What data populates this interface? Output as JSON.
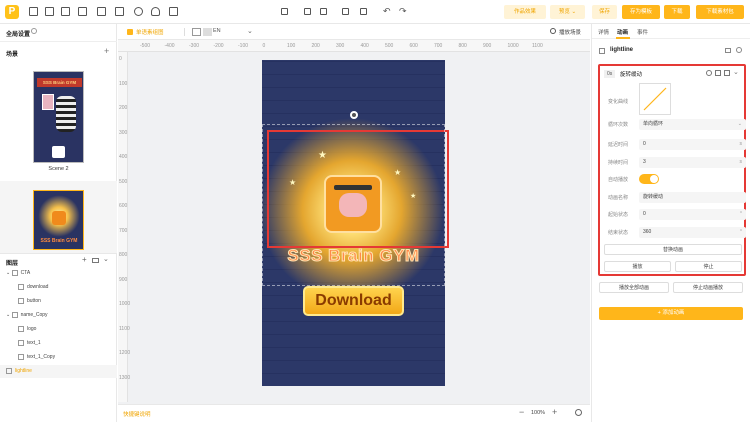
{
  "toolbar": {
    "logo": "P",
    "buttons": {
      "works_effect": "作品效果",
      "preview": "预览",
      "save": "保存",
      "save_as_template": "存为模板",
      "download": "下载",
      "download_package": "下载素材包"
    }
  },
  "left": {
    "global_settings": "全局设置",
    "scenes_title": "场景",
    "scene2_label": "Scene 2",
    "layers_title": "图层",
    "layers": [
      {
        "name": "CTA",
        "indent": 0,
        "kind": "folder"
      },
      {
        "name": "download",
        "indent": 1,
        "kind": "image"
      },
      {
        "name": "button",
        "indent": 1,
        "kind": "image"
      },
      {
        "name": "name_Copy",
        "indent": 0,
        "kind": "folder"
      },
      {
        "name": "logo",
        "indent": 1,
        "kind": "image"
      },
      {
        "name": "text_1",
        "indent": 1,
        "kind": "text"
      },
      {
        "name": "text_1_Copy",
        "indent": 1,
        "kind": "text"
      },
      {
        "name": "lightline",
        "indent": 0,
        "kind": "image",
        "selected": true
      }
    ]
  },
  "canvas": {
    "mode_label": "单语素组图",
    "lang": "EN",
    "play_scene": "播放场景",
    "ruler_top": [
      "-500",
      "-400",
      "-300",
      "-200",
      "-100",
      "0",
      "100",
      "200",
      "300",
      "400",
      "500",
      "600",
      "700",
      "800",
      "900",
      "1000",
      "1100"
    ],
    "ruler_left": [
      "0",
      "100",
      "200",
      "300",
      "400",
      "500",
      "600",
      "700",
      "800",
      "900",
      "1000",
      "1100",
      "1200",
      "1300"
    ],
    "game_title": "SSS Brain GYM",
    "cta_text": "Download",
    "footer_left": "快捷键说明",
    "zoom": "100%"
  },
  "right": {
    "tabs": [
      "详情",
      "动画",
      "事件"
    ],
    "layer_name": "lightline",
    "anim_time": "0s",
    "anim_type": "旋转缓动",
    "fields": [
      {
        "label": "变化曲线",
        "value": ""
      },
      {
        "label": "循环次数",
        "value": "单向循环"
      },
      {
        "label": "延迟时间",
        "value": "0"
      },
      {
        "label": "持续时间",
        "value": "3"
      },
      {
        "label": "自动播放",
        "value": ""
      },
      {
        "label": "动画名称",
        "value": "旋转缓动"
      },
      {
        "label": "起始状态",
        "value": "0"
      },
      {
        "label": "结束状态",
        "value": "360"
      }
    ],
    "replace_anim": "替换动画",
    "play": "播放",
    "stop": "停止",
    "play_all": "播放全部动画",
    "stop_all": "停止动画播放",
    "add_anim": "+ 添加动画"
  },
  "colors": {
    "accent": "#ffb61a",
    "highlight": "#e53935"
  }
}
